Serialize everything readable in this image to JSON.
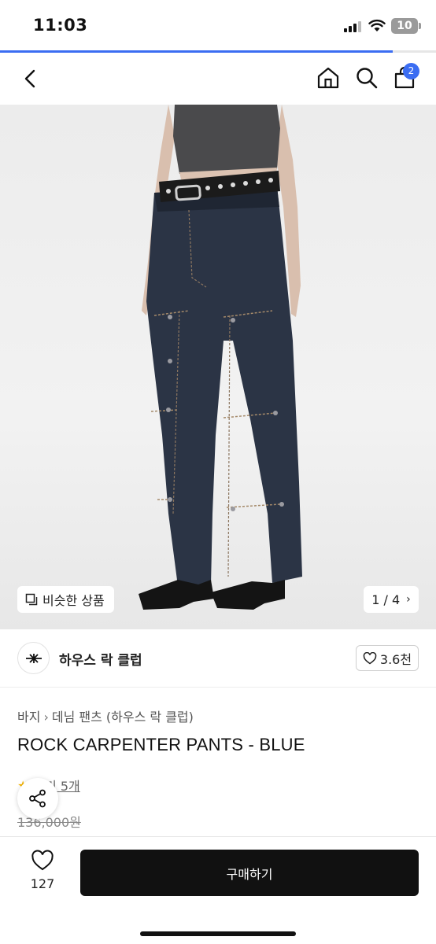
{
  "status_bar": {
    "time": "11:03",
    "battery": "10"
  },
  "page_progress": 0.9,
  "nav": {
    "cart_count": "2"
  },
  "gallery": {
    "similar_label": "비슷한 상품",
    "counter": "1 / 4"
  },
  "brand": {
    "name": "하우스 락 클럽",
    "likes": "3.6천"
  },
  "breadcrumb": {
    "category": "바지",
    "subcategory": "데님 팬츠 (하우스 락 클럽)"
  },
  "product": {
    "title": "ROCK CARPENTER PANTS - BLUE",
    "review_label": "후기 5개",
    "original_price": "136,000원"
  },
  "bottom_bar": {
    "wish_count": "127",
    "buy_label": "구매하기"
  },
  "colors": {
    "accent": "#3b6df2",
    "buy_button": "#111111"
  },
  "icons": [
    "back-arrow-icon",
    "home-icon",
    "search-icon",
    "cart-icon",
    "similar-items-icon",
    "chevron-right-icon",
    "brand-logo-icon",
    "heart-icon",
    "star-icon",
    "share-icon"
  ]
}
